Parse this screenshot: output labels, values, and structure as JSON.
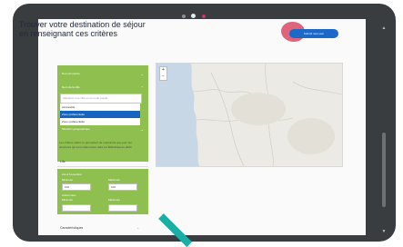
{
  "page": {
    "title_line1": "Trouver votre destination de séjour",
    "title_line2": "en renseignant ces critères",
    "submit_label": "Submit new user"
  },
  "filters": {
    "rows": [
      {
        "label": "Nom du centre"
      },
      {
        "label": "Nom de la ville"
      }
    ],
    "search_placeholder": "Saisissez une ville ou un code postal",
    "dropdown_options": [
      "Accessible",
      "Zone préférentielle",
      "Zone préférentielle"
    ],
    "selected_index": 1,
    "geo_label": "Situation géographique"
  },
  "note": "Les critères saisis ne permettent de restreindre que pour les structures qui sont référencées dans les Bibliothèques 2024.",
  "beds": {
    "section_label": "Lits",
    "label": "Lits à l'ouverture",
    "min_label": "Minimum",
    "max_label": "Maximum",
    "min_value": "100",
    "max_value": "100",
    "label2": "Autres lieux",
    "min_label2": "Minimum",
    "max_label2": "Maximum"
  },
  "bottom": {
    "section_label": "Caractéristiques"
  },
  "map": {
    "zoom_in": "+",
    "zoom_out": "−"
  },
  "colors": {
    "bezel": "#3a3d40",
    "filter_green": "#8fc04f",
    "primary_blue": "#1c69c9",
    "accent_pink": "#e0637c",
    "arrow_teal": "#19aea6"
  }
}
